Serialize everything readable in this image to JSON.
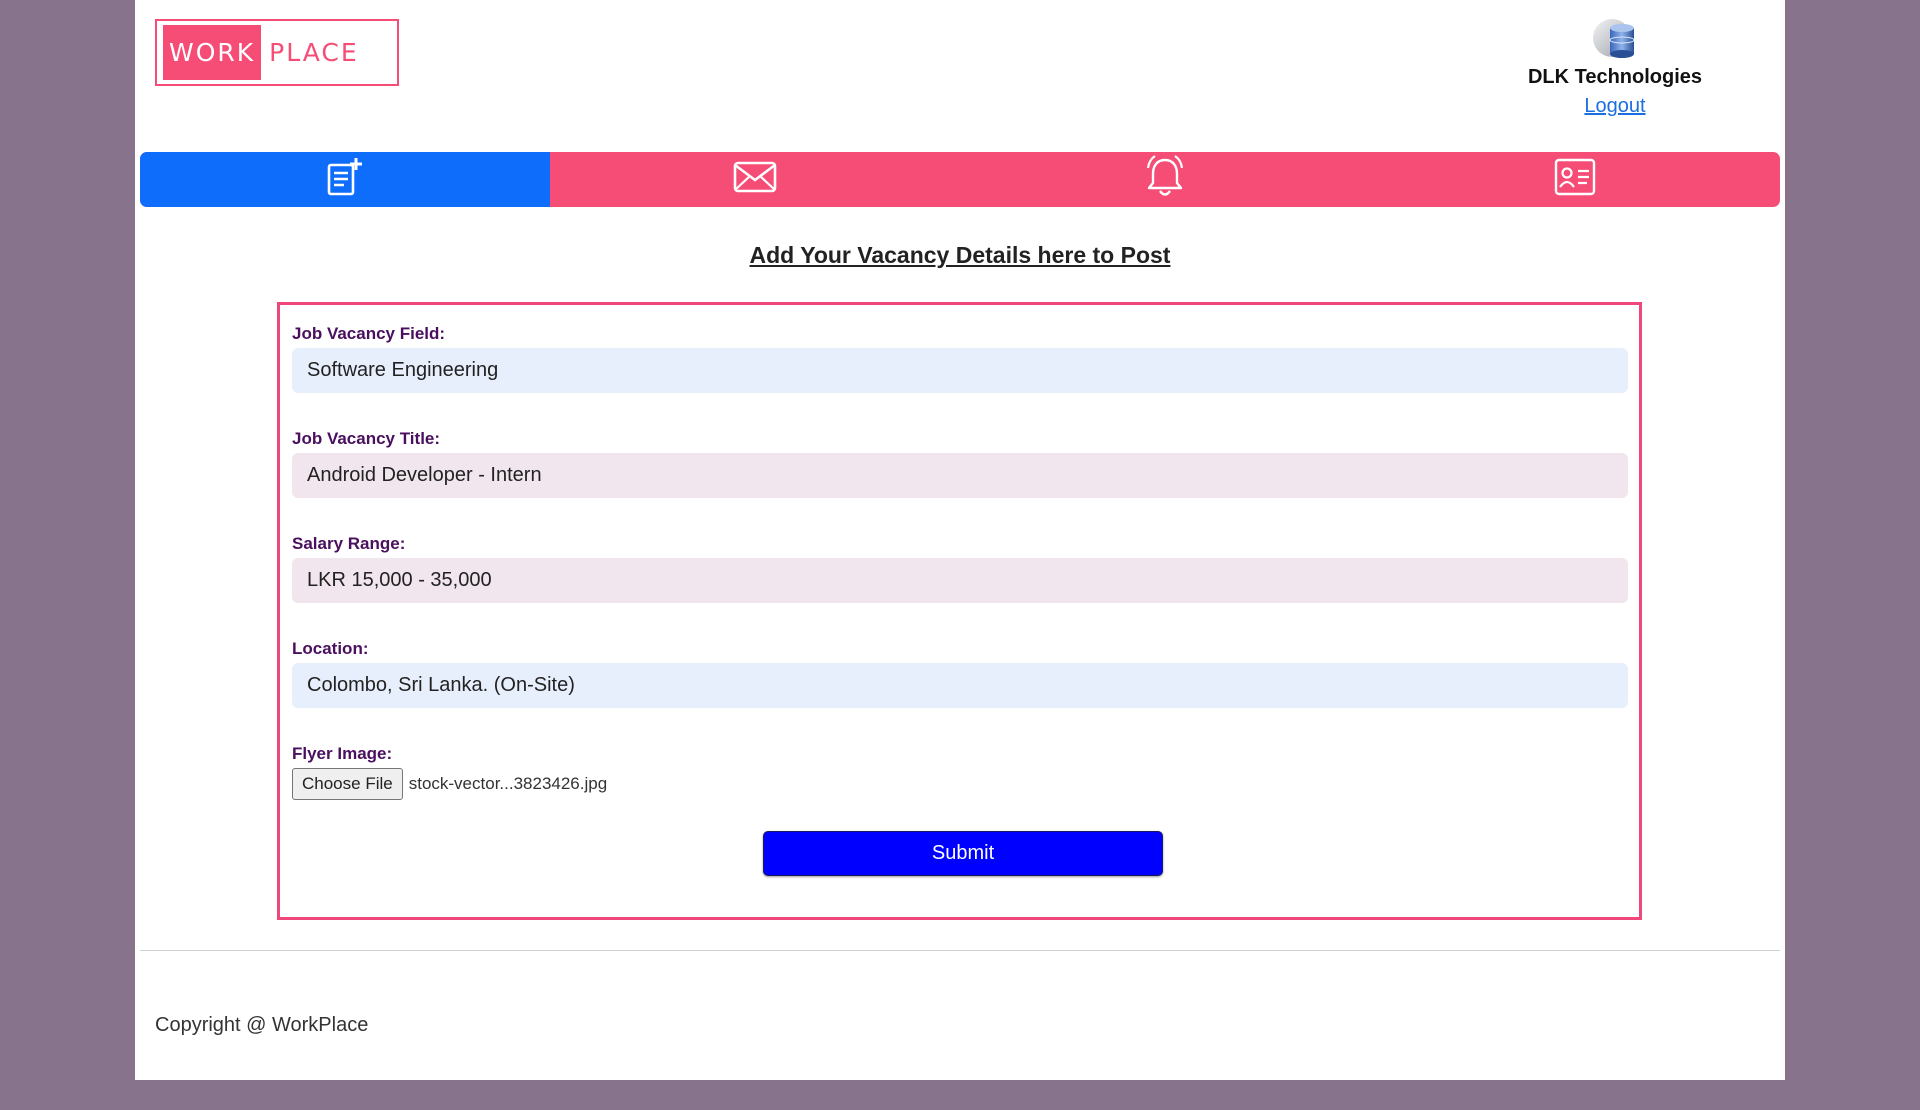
{
  "header": {
    "logo_left": "WORK",
    "logo_right": "PLACE",
    "company_name": "DLK Technologies",
    "logout_label": "Logout"
  },
  "nav": {
    "tabs": [
      {
        "icon": "post-add-icon",
        "active": true
      },
      {
        "icon": "envelope-icon",
        "active": false
      },
      {
        "icon": "bell-icon",
        "active": false
      },
      {
        "icon": "profile-card-icon",
        "active": false
      }
    ]
  },
  "main": {
    "heading": "Add Your Vacancy Details here to Post",
    "form": {
      "field_label": "Job Vacancy Field:",
      "field_value": "Software Engineering",
      "title_label": "Job Vacancy Title:",
      "title_value": "Android Developer - Intern",
      "salary_label": "Salary Range:",
      "salary_value": "LKR 15,000 - 35,000",
      "location_label": "Location:",
      "location_value": "Colombo, Sri Lanka. (On-Site)",
      "flyer_label": "Flyer Image:",
      "choose_file_label": "Choose File",
      "file_name": "stock-vector...3823426.jpg",
      "submit_label": "Submit"
    }
  },
  "footer": {
    "copyright": "Copyright @ WorkPlace"
  },
  "colors": {
    "brand_pink": "#f54d76",
    "active_tab": "#0f6dfc",
    "submit_blue": "#0000ff",
    "label_purple": "#4a0f5e",
    "backdrop": "#87738c"
  }
}
